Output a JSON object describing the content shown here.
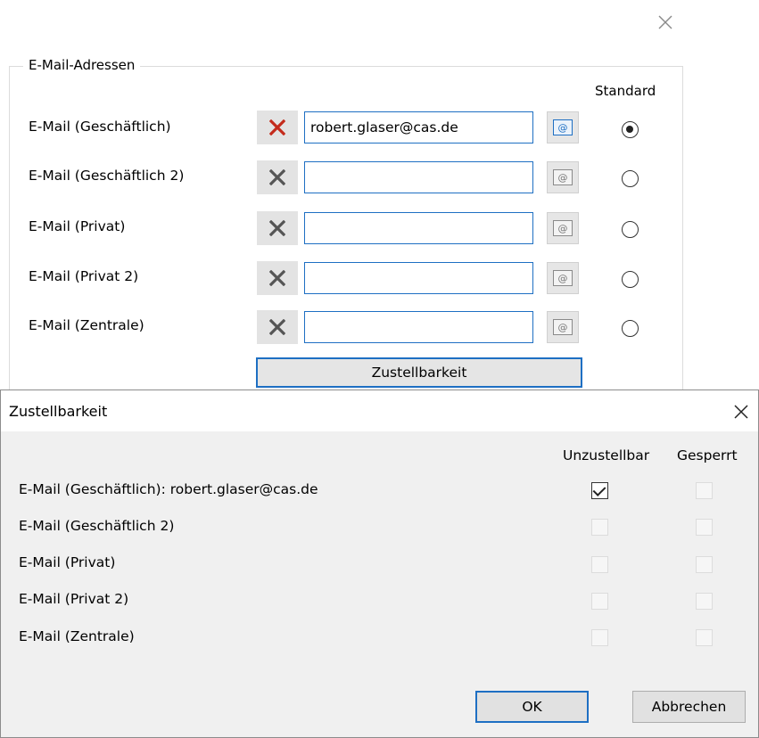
{
  "background_window": {
    "group_title": "E-Mail-Adressen",
    "standard_header": "Standard",
    "rows": [
      {
        "label": "E-Mail (Geschäftlich)",
        "value": "robert.glaser@cas.de",
        "is_standard": true,
        "active": true
      },
      {
        "label": "E-Mail (Geschäftlich 2)",
        "value": "",
        "is_standard": false,
        "active": false
      },
      {
        "label": "E-Mail (Privat)",
        "value": "",
        "is_standard": false,
        "active": false
      },
      {
        "label": "E-Mail (Privat 2)",
        "value": "",
        "is_standard": false,
        "active": false
      },
      {
        "label": "E-Mail (Zentrale)",
        "value": "",
        "is_standard": false,
        "active": false
      }
    ],
    "delivery_button": "Zustellbarkeit",
    "mail_glyph": "@",
    "icons": {
      "delete": "delete-x-icon",
      "mail": "email-link-icon",
      "close": "close-icon"
    },
    "colors": {
      "delete_active": "#c42b1c",
      "delete_inactive": "#555555",
      "accent": "#1e6fc3"
    }
  },
  "dialog": {
    "title": "Zustellbarkeit",
    "columns": {
      "undeliverable": "Unzustellbar",
      "blocked": "Gesperrt"
    },
    "rows": [
      {
        "label": "E-Mail (Geschäftlich): robert.glaser@cas.de",
        "undeliverable": true,
        "blocked": false
      },
      {
        "label": "E-Mail (Geschäftlich 2)",
        "undeliverable": false,
        "blocked": false
      },
      {
        "label": "E-Mail (Privat)",
        "undeliverable": false,
        "blocked": false
      },
      {
        "label": "E-Mail (Privat 2)",
        "undeliverable": false,
        "blocked": false
      },
      {
        "label": "E-Mail (Zentrale)",
        "undeliverable": false,
        "blocked": false
      }
    ],
    "ok_label": "OK",
    "cancel_label": "Abbrechen"
  }
}
